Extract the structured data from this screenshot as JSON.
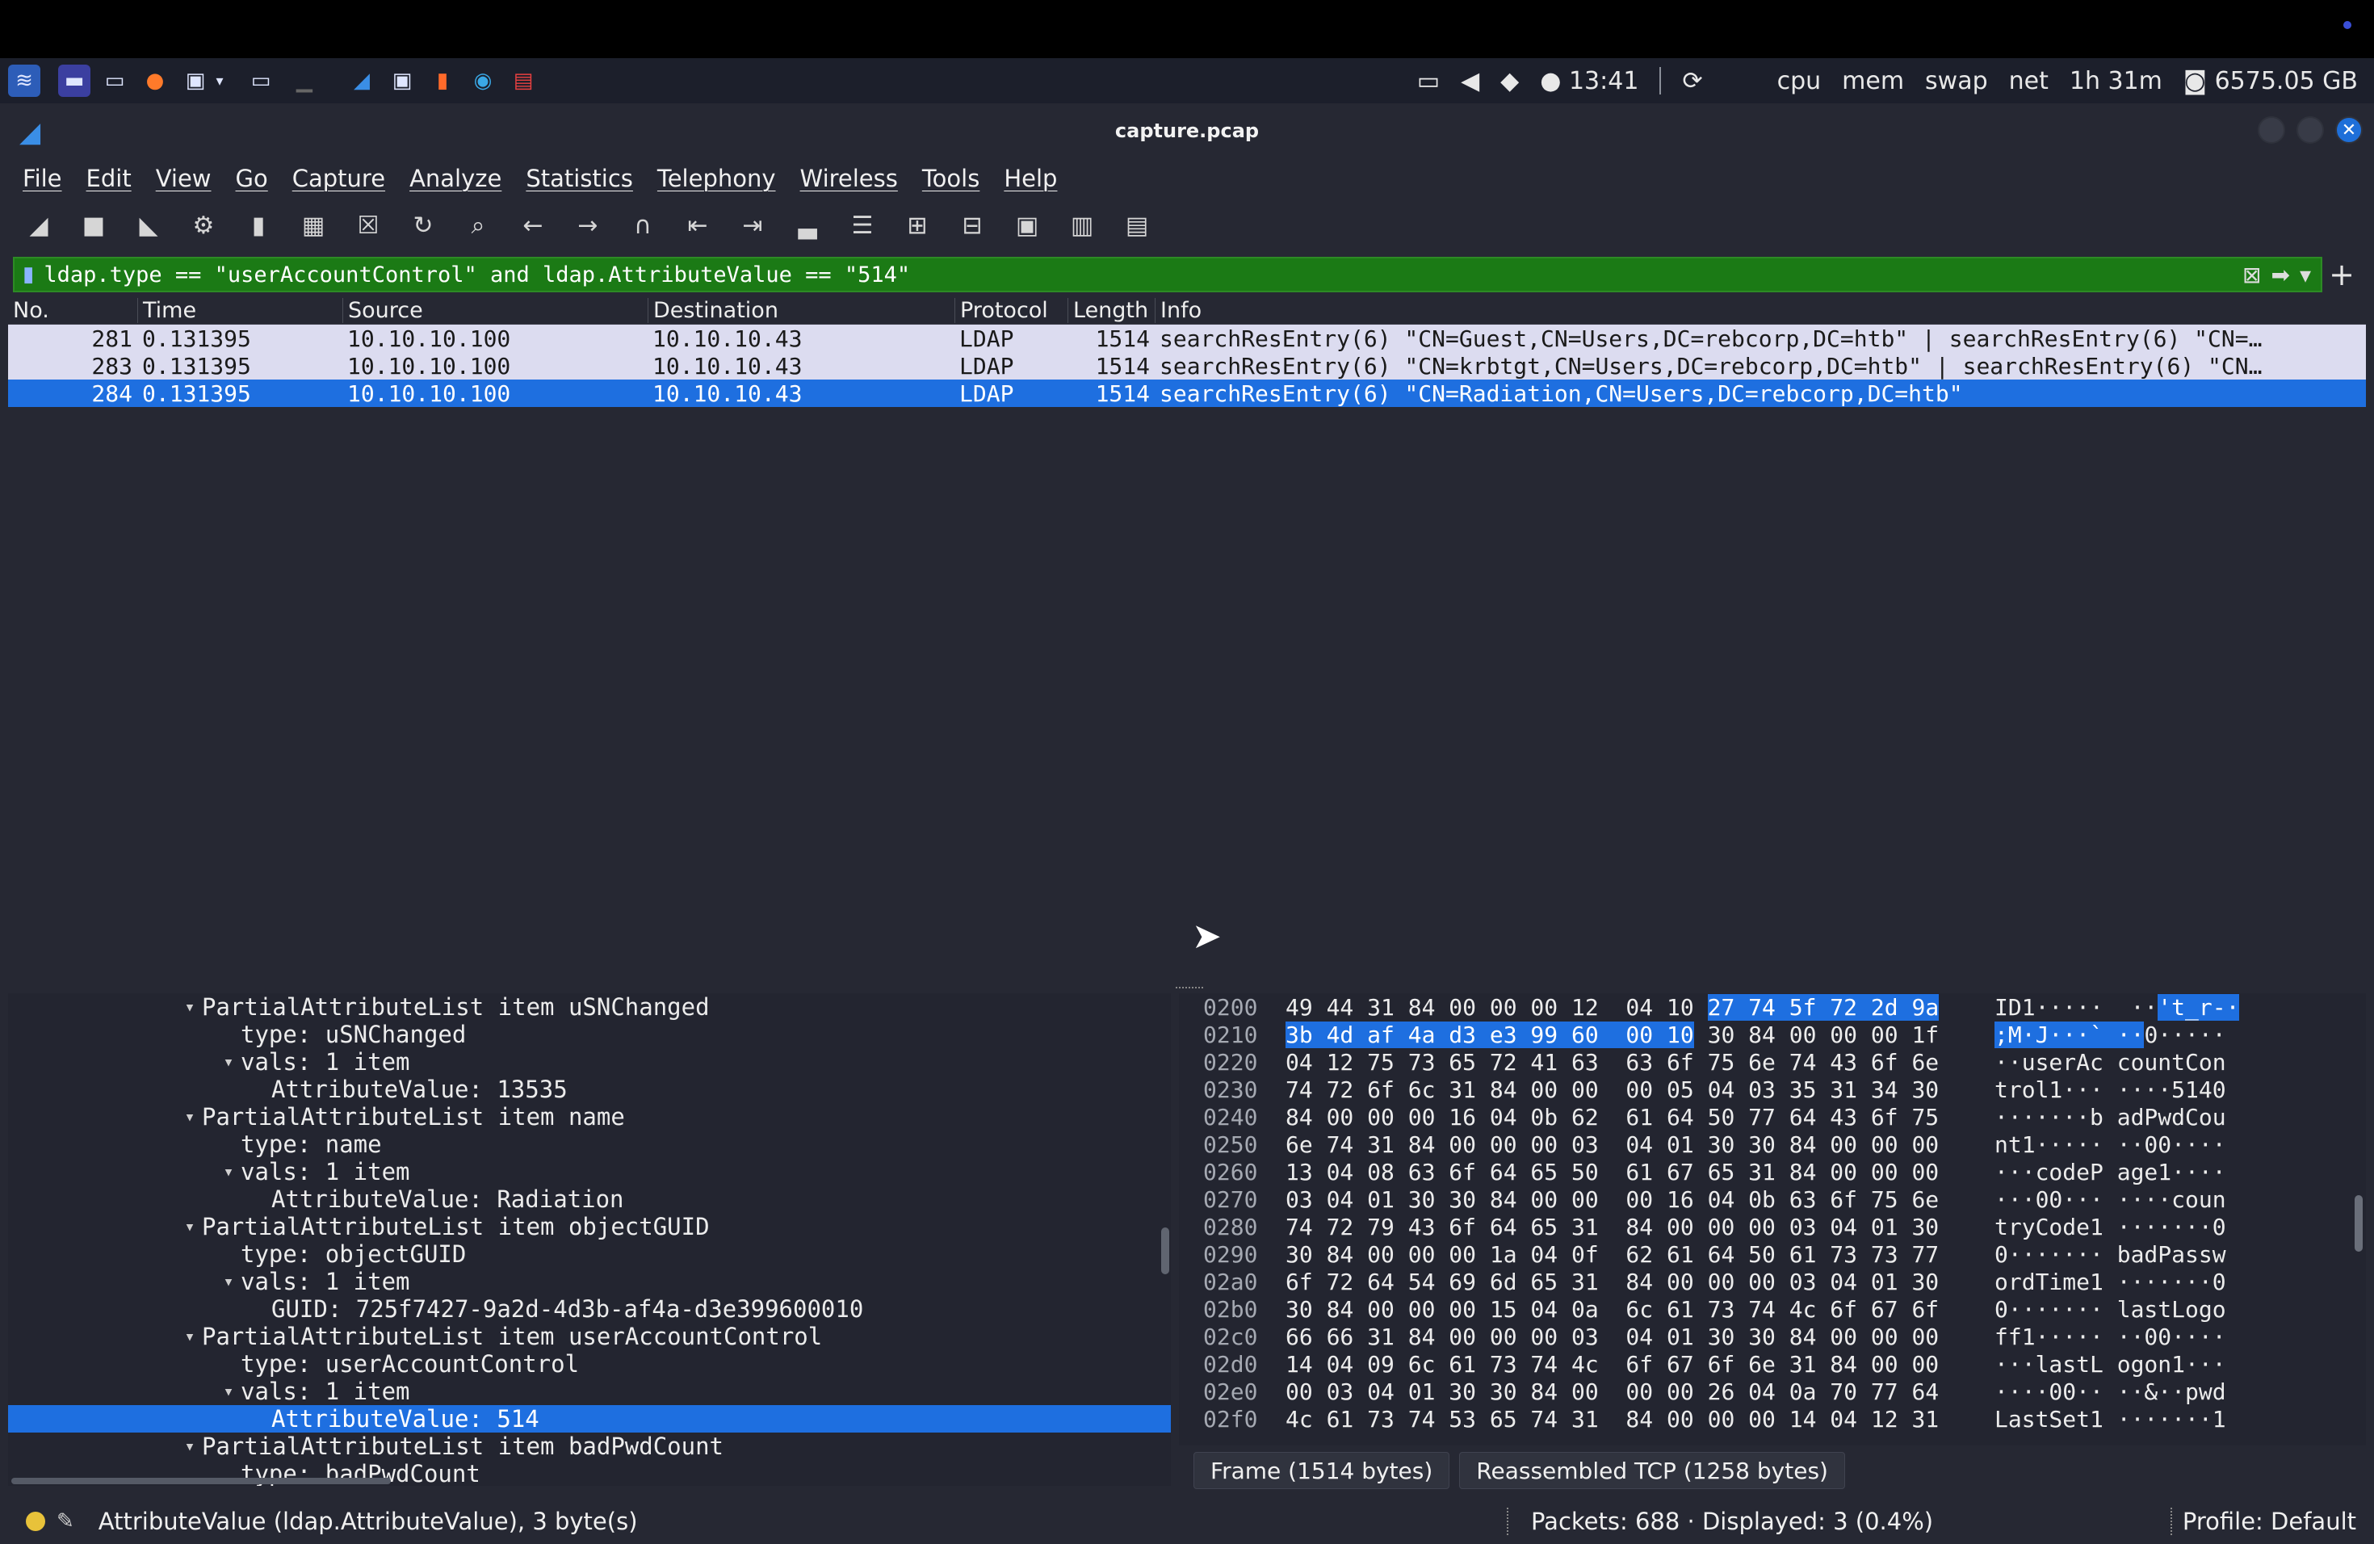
{
  "window": {
    "title": "capture.pcap"
  },
  "panel": {
    "time": "13:41",
    "monitors": [
      "cpu",
      "mem",
      "swap",
      "net"
    ],
    "uptime": "1h 31m",
    "disk": "6575.05 GB"
  },
  "menu": [
    "File",
    "Edit",
    "View",
    "Go",
    "Capture",
    "Analyze",
    "Statistics",
    "Telephony",
    "Wireless",
    "Tools",
    "Help"
  ],
  "filter": {
    "expression": "ldap.type == \"userAccountControl\" and ldap.AttributeValue == \"514\""
  },
  "packet_list": {
    "columns": [
      "No.",
      "Time",
      "Source",
      "Destination",
      "Protocol",
      "Length",
      "Info"
    ],
    "rows": [
      {
        "no": "281",
        "time": "0.131395",
        "src": "10.10.10.100",
        "dst": "10.10.10.43",
        "proto": "LDAP",
        "len": "1514",
        "info": "searchResEntry(6) \"CN=Guest,CN=Users,DC=rebcorp,DC=htb\"  | searchResEntry(6) \"CN=…"
      },
      {
        "no": "283",
        "time": "0.131395",
        "src": "10.10.10.100",
        "dst": "10.10.10.43",
        "proto": "LDAP",
        "len": "1514",
        "info": "searchResEntry(6) \"CN=krbtgt,CN=Users,DC=rebcorp,DC=htb\"  | searchResEntry(6) \"CN…"
      },
      {
        "no": "284",
        "time": "0.131395",
        "src": "10.10.10.100",
        "dst": "10.10.10.43",
        "proto": "LDAP",
        "len": "1514",
        "info": "searchResEntry(6) \"CN=Radiation,CN=Users,DC=rebcorp,DC=htb\""
      }
    ]
  },
  "details": [
    "PartialAttributeList item uSNChanged",
    "type: uSNChanged",
    "vals: 1 item",
    "AttributeValue: 13535",
    "PartialAttributeList item name",
    "type: name",
    "vals: 1 item",
    "AttributeValue: Radiation",
    "PartialAttributeList item objectGUID",
    "type: objectGUID",
    "vals: 1 item",
    "GUID: 725f7427-9a2d-4d3b-af4a-d3e399600010",
    "PartialAttributeList item userAccountControl",
    "type: userAccountControl",
    "vals: 1 item",
    "AttributeValue: 514",
    "PartialAttributeList item badPwdCount",
    "type: badPwdCount"
  ],
  "hex": [
    {
      "off": "0200",
      "b1": "49 44 31 84 00 00 00 12  04 10 ",
      "b2": "27 74 5f 72 2d 9a",
      "b3": "",
      "a1": "ID1·····  ··",
      "a2": "'t_r-·",
      "a3": ""
    },
    {
      "off": "0210",
      "b1": "",
      "b2": "3b 4d af 4a d3 e3 99 60  00 10",
      "b3": " 30 84 00 00 00 1f",
      "a1": "",
      "a2": ";M·J···` ··",
      "a3": "0·····"
    },
    {
      "off": "0220",
      "b1": "04 12 75 73 65 72 41 63  63 6f 75 6e 74 43 6f 6e",
      "b2": "",
      "b3": "",
      "a1": "··userAc countCon",
      "a2": "",
      "a3": ""
    },
    {
      "off": "0230",
      "b1": "74 72 6f 6c 31 84 00 00  00 05 04 03 35 31 34 30",
      "b2": "",
      "b3": "",
      "a1": "trol1··· ····5140",
      "a2": "",
      "a3": ""
    },
    {
      "off": "0240",
      "b1": "84 00 00 00 16 04 0b 62  61 64 50 77 64 43 6f 75",
      "b2": "",
      "b3": "",
      "a1": "·······b adPwdCou",
      "a2": "",
      "a3": ""
    },
    {
      "off": "0250",
      "b1": "6e 74 31 84 00 00 00 03  04 01 30 30 84 00 00 00",
      "b2": "",
      "b3": "",
      "a1": "nt1····· ··00····",
      "a2": "",
      "a3": ""
    },
    {
      "off": "0260",
      "b1": "13 04 08 63 6f 64 65 50  61 67 65 31 84 00 00 00",
      "b2": "",
      "b3": "",
      "a1": "···codeP age1····",
      "a2": "",
      "a3": ""
    },
    {
      "off": "0270",
      "b1": "03 04 01 30 30 84 00 00  00 16 04 0b 63 6f 75 6e",
      "b2": "",
      "b3": "",
      "a1": "···00··· ····coun",
      "a2": "",
      "a3": ""
    },
    {
      "off": "0280",
      "b1": "74 72 79 43 6f 64 65 31  84 00 00 00 03 04 01 30",
      "b2": "",
      "b3": "",
      "a1": "tryCode1 ·······0",
      "a2": "",
      "a3": ""
    },
    {
      "off": "0290",
      "b1": "30 84 00 00 00 1a 04 0f  62 61 64 50 61 73 73 77",
      "b2": "",
      "b3": "",
      "a1": "0······· badPassw",
      "a2": "",
      "a3": ""
    },
    {
      "off": "02a0",
      "b1": "6f 72 64 54 69 6d 65 31  84 00 00 00 03 04 01 30",
      "b2": "",
      "b3": "",
      "a1": "ordTime1 ·······0",
      "a2": "",
      "a3": ""
    },
    {
      "off": "02b0",
      "b1": "30 84 00 00 00 15 04 0a  6c 61 73 74 4c 6f 67 6f",
      "b2": "",
      "b3": "",
      "a1": "0······· lastLogo",
      "a2": "",
      "a3": ""
    },
    {
      "off": "02c0",
      "b1": "66 66 31 84 00 00 00 03  04 01 30 30 84 00 00 00",
      "b2": "",
      "b3": "",
      "a1": "ff1····· ··00····",
      "a2": "",
      "a3": ""
    },
    {
      "off": "02d0",
      "b1": "14 04 09 6c 61 73 74 4c  6f 67 6f 6e 31 84 00 00",
      "b2": "",
      "b3": "",
      "a1": "···lastL ogon1···",
      "a2": "",
      "a3": ""
    },
    {
      "off": "02e0",
      "b1": "00 03 04 01 30 30 84 00  00 00 26 04 0a 70 77 64",
      "b2": "",
      "b3": "",
      "a1": "····00·· ··&··pwd",
      "a2": "",
      "a3": ""
    },
    {
      "off": "02f0",
      "b1": "4c 61 73 74 53 65 74 31  84 00 00 00 14 04 12 31",
      "b2": "",
      "b3": "",
      "a1": "LastSet1 ·······1",
      "a2": "",
      "a3": ""
    }
  ],
  "hex_tabs": [
    "Frame (1514 bytes)",
    "Reassembled TCP (1258 bytes)"
  ],
  "status": {
    "field": "AttributeValue (ldap.AttributeValue), 3 byte(s)",
    "packets": "Packets: 688 · Displayed: 3 (0.4%)",
    "profile": "Profile: Default"
  },
  "colors": {
    "selection": "#1e6fe0",
    "filter_valid": "#1b7a15",
    "row_bg": "#dcdcf0"
  }
}
